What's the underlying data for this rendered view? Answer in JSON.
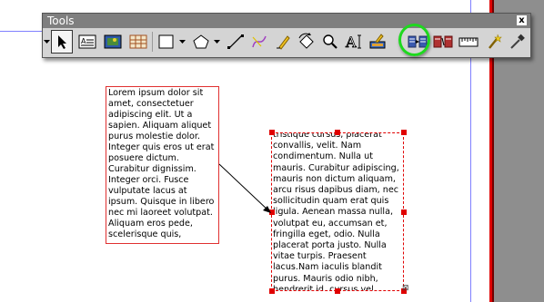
{
  "toolbar": {
    "title": "Tools",
    "close_label": "x",
    "tools": [
      {
        "name": "select",
        "icon": "arrow-pointer-icon",
        "selected": true
      },
      {
        "name": "insert-text-frame",
        "icon": "text-frame-icon"
      },
      {
        "name": "insert-image-frame",
        "icon": "image-frame-icon"
      },
      {
        "name": "insert-table",
        "icon": "table-icon"
      },
      {
        "name": "insert-shape",
        "icon": "rectangle-icon"
      },
      {
        "name": "insert-polygon",
        "icon": "pentagon-icon"
      },
      {
        "name": "insert-line",
        "icon": "line-icon"
      },
      {
        "name": "insert-bezier",
        "icon": "bezier-icon"
      },
      {
        "name": "freehand-line",
        "icon": "pencil-icon"
      },
      {
        "name": "rotate-item",
        "icon": "rotate-icon"
      },
      {
        "name": "zoom",
        "icon": "magnifier-icon"
      },
      {
        "name": "edit-text",
        "icon": "edit-text-icon"
      },
      {
        "name": "edit-contents",
        "icon": "edit-contents-icon"
      },
      {
        "name": "link-text-frames",
        "icon": "link-frames-icon",
        "highlighted": true
      },
      {
        "name": "unlink-text-frames",
        "icon": "unlink-frames-icon"
      },
      {
        "name": "measurements",
        "icon": "ruler-icon"
      },
      {
        "name": "copy-properties",
        "icon": "magic-wand-icon"
      },
      {
        "name": "eye-dropper",
        "icon": "eyedropper-icon"
      }
    ]
  },
  "frames": {
    "first_text": "Lorem ipsum dolor sit amet, consectetuer adipiscing elit. Ut a sapien. Aliquam aliquet purus molestie dolor. Integer quis eros ut erat posuere dictum. Curabitur dignissim. Integer orci. Fusce vulputate lacus at ipsum. Quisque in libero nec mi laoreet volutpat. Aliquam eros pede, scelerisque quis,",
    "second_text": "tristique cursus, placerat convallis, velit. Nam condimentum. Nulla ut mauris. Curabitur adipiscing, mauris non dictum aliquam, arcu risus dapibus diam, nec sollicitudin quam erat quis ligula. Aenean massa nulla, volutpat eu, accumsan et, fringilla eget, odio. Nulla placerat porta justo. Nulla vitae turpis. Praesent lacus.Nam iaculis blandit purus. Mauris odio nibh, hendrerit id, cursus vel,"
  },
  "colors": {
    "frame_border": "#e00000",
    "guide": "#8080ff",
    "highlight": "#1ed81e",
    "toolbar_title_bg": "#7f7f7f"
  }
}
